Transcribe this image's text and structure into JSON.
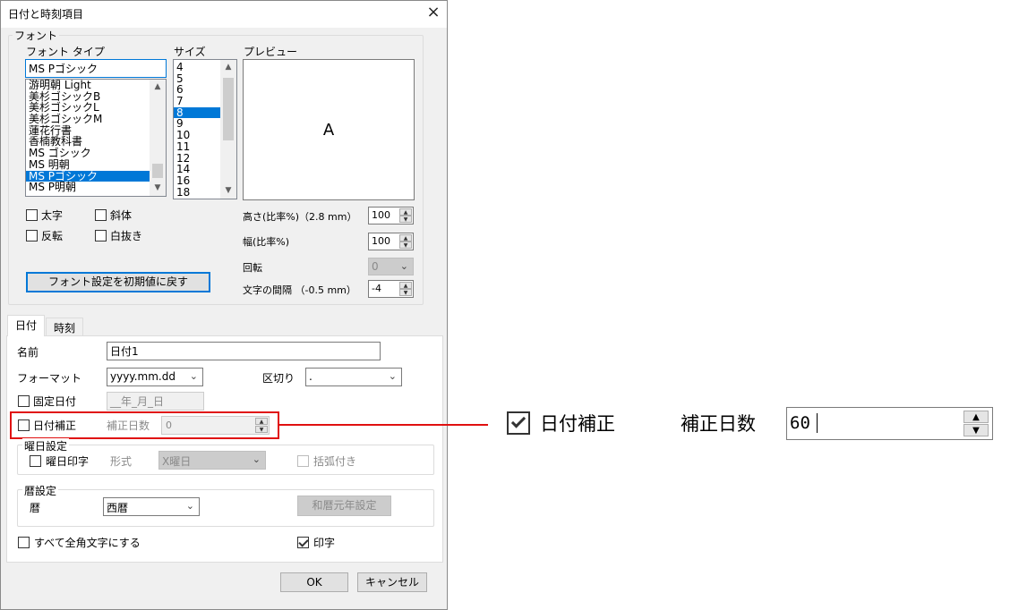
{
  "window": {
    "title": "日付と時刻項目",
    "close_label": "×"
  },
  "font": {
    "group_label": "フォント",
    "type_label": "フォント タイプ",
    "type_value": "MS Pゴシック",
    "font_list": [
      "游明朝 Light",
      "美杉ゴシックB",
      "美杉ゴシックL",
      "美杉ゴシックM",
      "蓮花行書",
      "香楠教科書",
      "MS ゴシック",
      "MS 明朝",
      "MS Pゴシック",
      "MS P明朝"
    ],
    "font_selected": "MS Pゴシック",
    "size_label": "サイズ",
    "size_list": [
      "4",
      "5",
      "6",
      "7",
      "8",
      "9",
      "10",
      "11",
      "12",
      "14",
      "16",
      "18"
    ],
    "size_selected": "8",
    "preview_label": "プレビュー",
    "preview_text": "A",
    "bold_label": "太字",
    "italic_label": "斜体",
    "reverse_label": "反転",
    "outline_label": "白抜き",
    "height_label": "高さ(比率%)（2.8 mm）",
    "height_value": "100",
    "width_label": "幅(比率%)",
    "width_value": "100",
    "rotation_label": "回転",
    "rotation_value": "0",
    "spacing_label": "文字の間隔 （-0.5 mm）",
    "spacing_value": "-4",
    "reset_button": "フォント設定を初期値に戻す"
  },
  "tabs": [
    {
      "label": "日付"
    },
    {
      "label": "時刻"
    }
  ],
  "date": {
    "name_label": "名前",
    "name_value": "日付1",
    "format_label": "フォーマット",
    "format_value": "yyyy.mm.dd",
    "separator_label": "区切り",
    "separator_value": ".",
    "fixed_date_label": "固定日付",
    "fixed_date_value": "__年_月_日",
    "correction_label": "日付補正",
    "correction_days_label": "補正日数",
    "correction_days_value": "0",
    "weekday_group": "曜日設定",
    "weekday_print_label": "曜日印字",
    "weekday_format_label": "形式",
    "weekday_format_value": "X曜日",
    "bracket_label": "括弧付き",
    "calendar_group": "暦設定",
    "calendar_label": "暦",
    "calendar_value": "西暦",
    "wareki_button": "和暦元年設定",
    "fullwidth_label": "すべて全角文字にする",
    "print_label": "印字",
    "print_checked": true
  },
  "buttons": {
    "ok": "OK",
    "cancel": "キャンセル"
  },
  "zoom": {
    "correction_label": "日付補正",
    "correction_checked": true,
    "days_label": "補正日数",
    "days_value": "60"
  },
  "colors": {
    "accent": "#0078d7",
    "callout": "#e01010"
  }
}
